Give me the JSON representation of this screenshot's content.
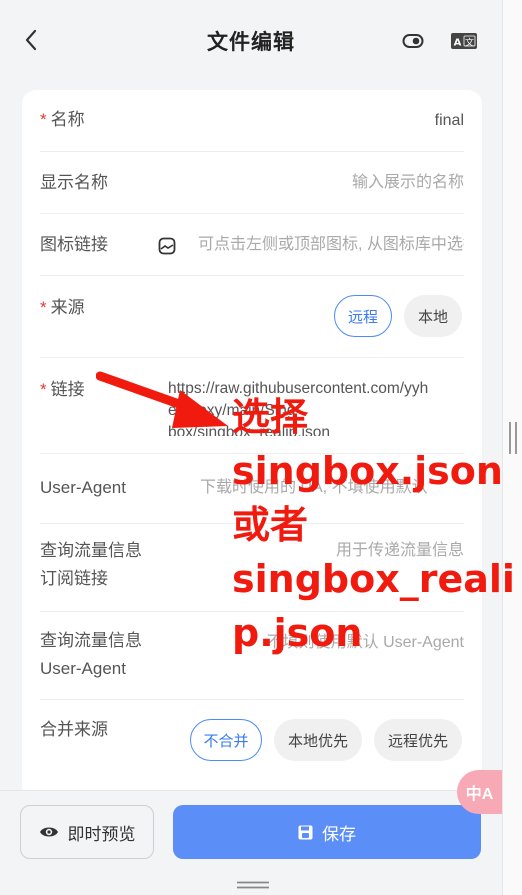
{
  "header": {
    "title": "文件编辑"
  },
  "form": {
    "name": {
      "label": "名称",
      "value": "final"
    },
    "display_name": {
      "label": "显示名称",
      "placeholder": "输入展示的名称"
    },
    "icon_link": {
      "label": "图标链接",
      "placeholder": "可点击左侧或顶部图标, 从图标库中选择"
    },
    "source": {
      "label": "来源",
      "options": [
        "远程",
        "本地"
      ],
      "selected": "远程"
    },
    "link": {
      "label": "链接",
      "value_lines": [
        "https://raw.githubusercontent.com/yyh",
        "elfproxy/main/Sing-",
        "box/singbox_realip.json"
      ]
    },
    "user_agent": {
      "label": "User-Agent",
      "placeholder": "下载时使用的 UA, 不填使用默认"
    },
    "traffic_link": {
      "label_lines": [
        "查询流量信息",
        "订阅链接"
      ],
      "placeholder": "用于传递流量信息"
    },
    "traffic_ua": {
      "label_lines": [
        "查询流量信息",
        "User-Agent"
      ],
      "placeholder": "不填则使用默认 User-Agent"
    },
    "merge": {
      "label": "合并来源",
      "options": [
        "不合并",
        "本地优先",
        "远程优先"
      ],
      "selected": "不合并"
    }
  },
  "bottom": {
    "preview_label": "即时预览",
    "save_label": "保存"
  },
  "annotation": {
    "lines": [
      "选择",
      "singbox.json",
      "或者",
      "singbox_reali",
      "p.json"
    ]
  },
  "float_button": {
    "label": "中A"
  },
  "colors": {
    "accent": "#5b8ff7",
    "required": "#e53935",
    "annotation": "#f11a0f"
  }
}
